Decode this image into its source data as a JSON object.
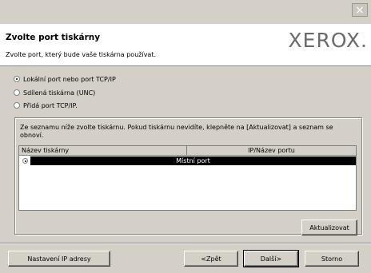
{
  "window": {
    "close_glyph": "×"
  },
  "header": {
    "title": "Zvolte port tiskárny",
    "subtitle": "Zvolte port, který bude vaše tiskárna používat.",
    "logo": "XEROX."
  },
  "options": [
    {
      "label": "Lokální port nebo port TCP/IP",
      "checked": true
    },
    {
      "label": "Sdílená tiskárna (UNC)",
      "checked": false
    },
    {
      "label": "Přidá port TCP/IP.",
      "checked": false
    }
  ],
  "group": {
    "instructions": "Ze seznamu níže zvolte tiskárnu. Pokud tiskárnu nevidíte, klepněte na [Aktualizovat] a seznam se obnoví.",
    "columns": [
      "Název tiskárny",
      "IP/Název portu"
    ],
    "rows": [
      {
        "name": "",
        "port": "Místní port",
        "selected": true
      }
    ],
    "refresh_label": "Aktualizovat"
  },
  "footer": {
    "ip_settings_label": "Nastavení IP adresy",
    "back_label": "<Zpět",
    "next_label": "Další>",
    "cancel_label": "Storno"
  }
}
